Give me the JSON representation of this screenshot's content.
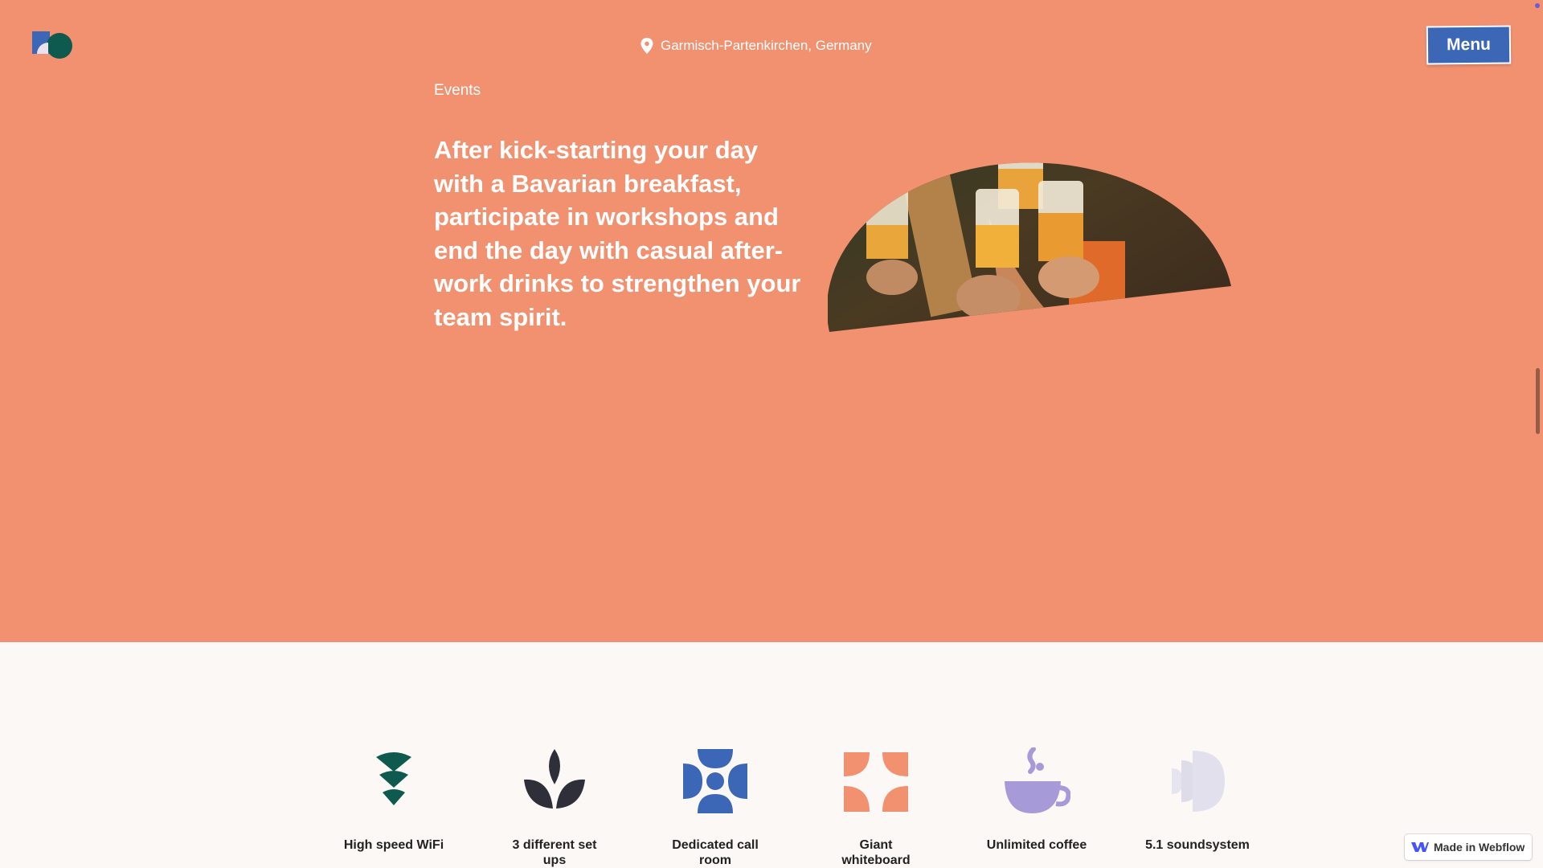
{
  "header": {
    "location": "Garmisch-Partenkirchen, Germany",
    "menu_label": "Menu"
  },
  "hero": {
    "eyebrow": "Events",
    "headline": "After kick-starting your day with a Bavarian breakfast, participate in workshops and end the day with casual after-work drinks to strengthen your team spirit.",
    "background_color": "#f19170"
  },
  "amenities": [
    {
      "label": "High speed WiFi",
      "icon": "wifi-icon",
      "color": "#0e5a4f"
    },
    {
      "label": "3 different set ups",
      "icon": "leaf-icon",
      "color": "#2f2f3a"
    },
    {
      "label": "Dedicated call room",
      "icon": "call-room-icon",
      "color": "#3c67b6"
    },
    {
      "label": "Giant whiteboard",
      "icon": "whiteboard-icon",
      "color": "#f19170"
    },
    {
      "label": "Unlimited coffee",
      "icon": "coffee-icon",
      "color": "#a79ad8"
    },
    {
      "label": "5.1 soundsystem",
      "icon": "speaker-icon",
      "color": "#dcdce8"
    }
  ],
  "badge": {
    "label": "Made in Webflow"
  },
  "colors": {
    "accent_blue": "#3c67b6",
    "dark_green": "#0e5a4f",
    "coral": "#f19170"
  }
}
